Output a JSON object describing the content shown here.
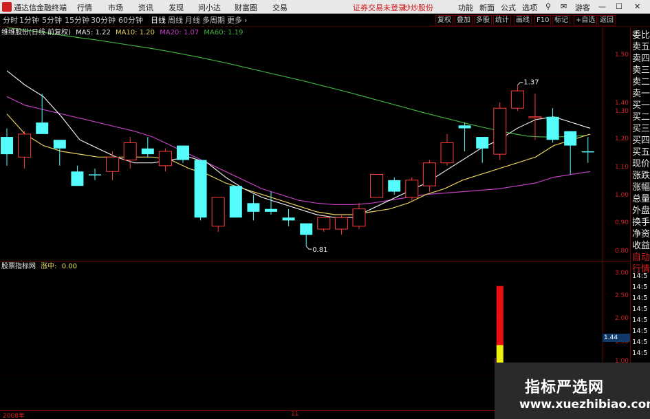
{
  "titlebar": {
    "app_name": "通达信金融终端",
    "menus": [
      "行情",
      "市场",
      "资讯",
      "发现",
      "问小达",
      "财富圈",
      "交易"
    ],
    "notice": "证券交易未登录",
    "notice2": "炒炒股份",
    "right_items": [
      "功能",
      "新面",
      "公式",
      "选项"
    ],
    "guest": "游客"
  },
  "toolbar": {
    "periods": [
      "分时",
      "1分钟",
      "5分钟",
      "15分钟",
      "30分钟",
      "60分钟",
      "日线",
      "周线",
      "月线",
      "多周期",
      "更多"
    ],
    "active_period": "日线",
    "right_buttons": [
      "复权",
      "叠加",
      "多股",
      "统计",
      "画线",
      "F10",
      "标记",
      "+自选",
      "返回"
    ]
  },
  "legend_main": {
    "stock": "维维股份(日线 前复权)",
    "ma5": "MA5: 1.22",
    "ma10": "MA10: 1.20",
    "ma20": "MA20: 1.07",
    "ma60": "MA60: 1.19",
    "colors": {
      "ma5": "#e8e8e8",
      "ma10": "#e8d060",
      "ma20": "#c040c0",
      "ma60": "#40b040"
    }
  },
  "legend_ind": {
    "name": "股票指标网",
    "label": "涨中:",
    "value": "0.00"
  },
  "price_axis": [
    "1.50",
    "1.40",
    "1.30",
    "1.20",
    "1.10",
    "1.00",
    "0.90",
    "0.80"
  ],
  "ind_axis": [
    "3.00",
    "2.50",
    "2.00",
    "1.50",
    "1.00"
  ],
  "price_tag": "1.44",
  "annotations": {
    "high": "1.37",
    "low": "0.81"
  },
  "chart_data": {
    "type": "candlestick",
    "ylim": [
      0.76,
      1.57
    ],
    "candles": [
      {
        "o": 1.19,
        "c": 1.13,
        "h": 1.22,
        "l": 1.09,
        "up": false
      },
      {
        "o": 1.12,
        "c": 1.2,
        "h": 1.21,
        "l": 1.08,
        "up": true
      },
      {
        "o": 1.2,
        "c": 1.24,
        "h": 1.34,
        "l": 1.2,
        "up": false
      },
      {
        "o": 1.18,
        "c": 1.15,
        "h": 1.18,
        "l": 1.09,
        "up": false
      },
      {
        "o": 1.07,
        "c": 1.02,
        "h": 1.09,
        "l": 1.02,
        "up": false
      },
      {
        "o": 1.06,
        "c": 1.06,
        "h": 1.08,
        "l": 1.04,
        "up": false
      },
      {
        "o": 1.07,
        "c": 1.12,
        "h": 1.14,
        "l": 1.04,
        "up": true
      },
      {
        "o": 1.11,
        "c": 1.17,
        "h": 1.19,
        "l": 1.08,
        "up": true
      },
      {
        "o": 1.15,
        "c": 1.13,
        "h": 1.19,
        "l": 1.12,
        "up": false
      },
      {
        "o": 1.09,
        "c": 1.14,
        "h": 1.15,
        "l": 1.07,
        "up": true
      },
      {
        "o": 1.16,
        "c": 1.11,
        "h": 1.16,
        "l": 1.1,
        "up": false
      },
      {
        "o": 1.11,
        "c": 0.91,
        "h": 1.11,
        "l": 0.9,
        "up": false
      },
      {
        "o": 0.88,
        "c": 0.98,
        "h": 0.98,
        "l": 0.86,
        "up": true
      },
      {
        "o": 1.02,
        "c": 0.91,
        "h": 1.02,
        "l": 0.91,
        "up": false
      },
      {
        "o": 0.96,
        "c": 0.93,
        "h": 0.99,
        "l": 0.9,
        "up": false
      },
      {
        "o": 0.94,
        "c": 0.93,
        "h": 1.0,
        "l": 0.92,
        "up": false
      },
      {
        "o": 0.91,
        "c": 0.9,
        "h": 0.94,
        "l": 0.88,
        "up": false
      },
      {
        "o": 0.89,
        "c": 0.85,
        "h": 0.89,
        "l": 0.81,
        "up": false
      },
      {
        "o": 0.87,
        "c": 0.91,
        "h": 0.91,
        "l": 0.86,
        "up": true
      },
      {
        "o": 0.87,
        "c": 0.91,
        "h": 0.92,
        "l": 0.85,
        "up": true
      },
      {
        "o": 0.88,
        "c": 0.94,
        "h": 0.96,
        "l": 0.87,
        "up": true
      },
      {
        "o": 0.98,
        "c": 1.06,
        "h": 1.06,
        "l": 0.98,
        "up": true
      },
      {
        "o": 1.04,
        "c": 1.0,
        "h": 1.05,
        "l": 0.99,
        "up": false
      },
      {
        "o": 0.98,
        "c": 1.04,
        "h": 1.05,
        "l": 0.97,
        "up": true
      },
      {
        "o": 1.02,
        "c": 1.1,
        "h": 1.11,
        "l": 1.0,
        "up": true
      },
      {
        "o": 1.1,
        "c": 1.17,
        "h": 1.2,
        "l": 1.09,
        "up": true
      },
      {
        "o": 1.23,
        "c": 1.22,
        "h": 1.24,
        "l": 1.14,
        "up": false
      },
      {
        "o": 1.19,
        "c": 1.15,
        "h": 1.19,
        "l": 1.1,
        "up": false
      },
      {
        "o": 1.13,
        "c": 1.29,
        "h": 1.31,
        "l": 1.11,
        "up": true
      },
      {
        "o": 1.29,
        "c": 1.35,
        "h": 1.37,
        "l": 1.28,
        "up": true
      },
      {
        "o": 1.26,
        "c": 1.26,
        "h": 1.34,
        "l": 1.18,
        "up": true
      },
      {
        "o": 1.26,
        "c": 1.18,
        "h": 1.29,
        "l": 1.17,
        "up": false
      },
      {
        "o": 1.21,
        "c": 1.16,
        "h": 1.21,
        "l": 1.06,
        "up": false
      },
      {
        "o": 1.14,
        "c": 1.14,
        "h": 1.19,
        "l": 1.1,
        "up": false
      }
    ],
    "ma60": [
      1.57,
      1.563,
      1.556,
      1.549,
      1.541,
      1.534,
      1.527,
      1.519,
      1.511,
      1.503,
      1.495,
      1.486,
      1.476,
      1.466,
      1.455,
      1.444,
      1.432,
      1.42,
      1.408,
      1.396,
      1.384,
      1.371,
      1.358,
      1.345,
      1.331,
      1.317,
      1.303,
      1.289,
      1.275,
      1.262,
      1.249,
      1.236,
      1.224,
      1.213,
      1.202,
      1.193,
      1.19,
      1.19,
      1.192,
      1.195
    ],
    "ma20": [
      1.33,
      1.3,
      1.285,
      1.27,
      1.255,
      1.24,
      1.225,
      1.21,
      1.19,
      1.16,
      1.13,
      1.1,
      1.07,
      1.04,
      1.01,
      0.99,
      0.97,
      0.96,
      0.955,
      0.955,
      0.96,
      0.97,
      0.98,
      0.99,
      0.995,
      1.0,
      1.005,
      1.01,
      1.02,
      1.03,
      1.05,
      1.06,
      1.07
    ],
    "ma5": [
      1.42,
      1.37,
      1.33,
      1.26,
      1.18,
      1.15,
      1.12,
      1.1,
      1.1,
      1.11,
      1.12,
      1.1,
      1.05,
      1.01,
      0.98,
      0.96,
      0.94,
      0.92,
      0.91,
      0.91,
      0.94,
      0.97,
      1.0,
      1.03,
      1.07,
      1.11,
      1.15,
      1.18,
      1.22,
      1.25,
      1.26,
      1.24,
      1.22
    ],
    "ma10": [
      1.27,
      1.2,
      1.16,
      1.14,
      1.13,
      1.12,
      1.12,
      1.12,
      1.12,
      1.11,
      1.08,
      1.06,
      1.03,
      1.01,
      0.99,
      0.97,
      0.95,
      0.93,
      0.92,
      0.92,
      0.93,
      0.94,
      0.96,
      0.99,
      1.01,
      1.04,
      1.06,
      1.08,
      1.1,
      1.12,
      1.16,
      1.18,
      1.2
    ],
    "indicator": {
      "ylim": [
        0.9,
        3.3
      ],
      "bar": {
        "index": 28,
        "red_top": 3.0,
        "yellow_top": 2.0,
        "bottom": 0.9
      }
    }
  },
  "sidepanel": {
    "items": [
      "委比",
      "卖五",
      "卖四",
      "卖三",
      "卖二",
      "卖一",
      "买一",
      "买二",
      "买三",
      "买四",
      "买五",
      "现价",
      "涨跌",
      "涨幅",
      "总量",
      "外盘",
      "换手",
      "净资",
      "收益",
      "自动",
      "行情",
      "14:5",
      "14:5",
      "14:5",
      "14:5",
      "14:5",
      "14:5",
      "14:5",
      "14:5"
    ]
  },
  "bottom": {
    "date_left": "2008年",
    "date_mid": "11"
  },
  "watermark": {
    "line1": "指标严选网",
    "line2": "www.xuezhibiao.com"
  }
}
